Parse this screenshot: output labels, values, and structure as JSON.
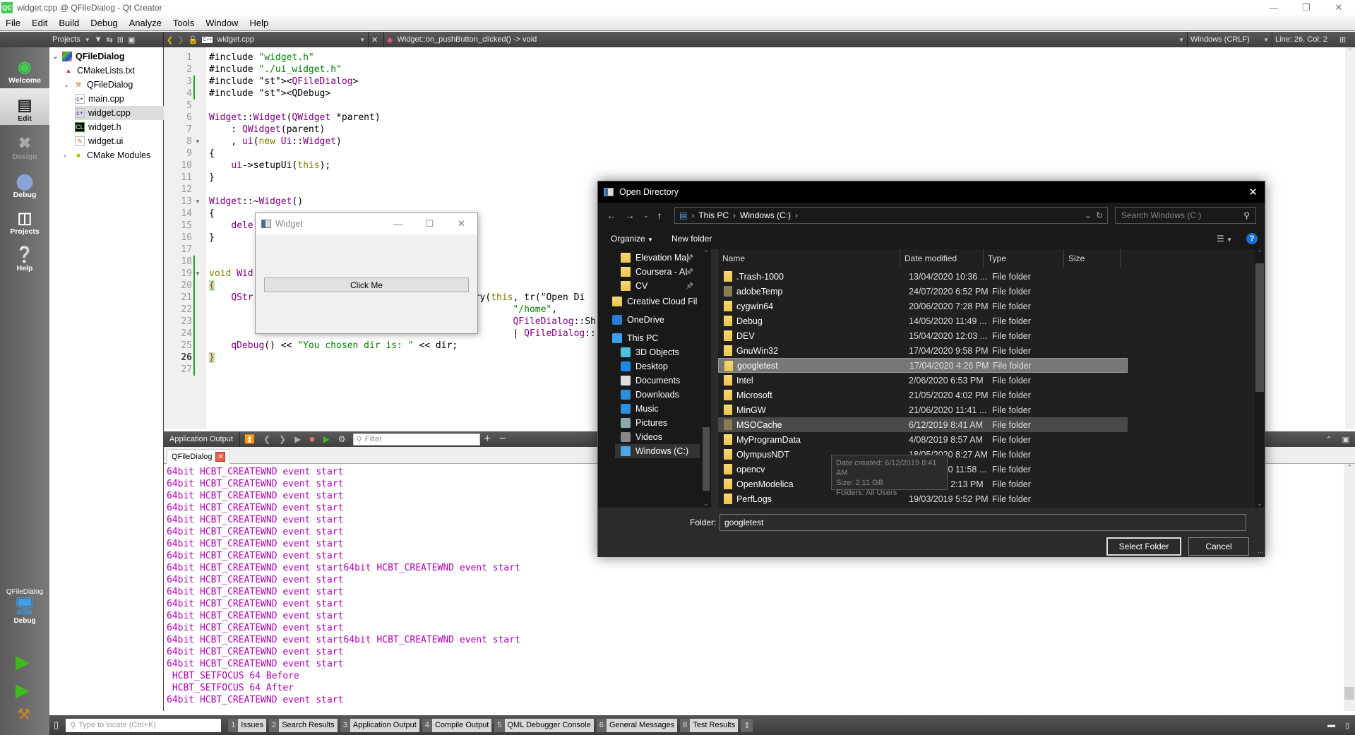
{
  "window": {
    "title": "widget.cpp @ QFileDialog - Qt Creator",
    "app_icon": "QC",
    "controls": [
      "minimize",
      "restore",
      "close"
    ]
  },
  "menubar": [
    "File",
    "Edit",
    "Build",
    "Debug",
    "Analyze",
    "Tools",
    "Window",
    "Help"
  ],
  "editor_toolbar": {
    "projects_label": "Projects",
    "file_name": "widget.cpp",
    "symbol": "Widget::on_pushButton_clicked() -> void",
    "line_ending": "Windows (CRLF)",
    "cursor_position": "Line: 26, Col: 2"
  },
  "modes": [
    {
      "label": "Welcome",
      "icon": "qt-logo-icon",
      "state": "normal"
    },
    {
      "label": "Edit",
      "icon": "edit-document-icon",
      "state": "active"
    },
    {
      "label": "Design",
      "icon": "design-tools-icon",
      "state": "disabled"
    },
    {
      "label": "Debug",
      "icon": "bug-icon",
      "state": "normal"
    },
    {
      "label": "Projects",
      "icon": "projects-folder-icon",
      "state": "normal"
    },
    {
      "label": "Help",
      "icon": "help-icon",
      "state": "normal"
    }
  ],
  "kit_selector": {
    "project": "QFileDialog",
    "config": "Debug"
  },
  "project_tree": [
    {
      "label": "QFileDialog",
      "level": 0,
      "expanded": true,
      "bold": true,
      "icon": "project-icon"
    },
    {
      "label": "CMakeLists.txt",
      "level": 1,
      "icon": "cmake-icon"
    },
    {
      "label": "QFileDialog",
      "level": 1,
      "expanded": true,
      "icon": "build-hammer-icon"
    },
    {
      "label": "main.cpp",
      "level": 2,
      "icon": "cpp-file-icon"
    },
    {
      "label": "widget.cpp",
      "level": 2,
      "icon": "cpp-file-icon",
      "selected": true
    },
    {
      "label": "widget.h",
      "level": 2,
      "icon": "header-file-icon"
    },
    {
      "label": "widget.ui",
      "level": 2,
      "icon": "ui-file-icon"
    },
    {
      "label": "CMake Modules",
      "level": 1,
      "expanded": false,
      "icon": "cmake-modules-icon"
    }
  ],
  "code": {
    "current_line": 26,
    "lines": [
      "#include \"widget.h\"",
      "#include \"./ui_widget.h\"",
      "#include <QFileDialog>",
      "#include <QDebug>",
      "",
      "Widget::Widget(QWidget *parent)",
      "    : QWidget(parent)",
      "    , ui(new Ui::Widget)",
      "{",
      "    ui->setupUi(this);",
      "}",
      "",
      "Widget::~Widget()",
      "{",
      "    dele",
      "}",
      "",
      "",
      "void Wid",
      "{",
      "    QStr                                      tory(this, tr(\"Open Di",
      "                                                       \"/home\",",
      "                                                       QFileDialog::Sh",
      "                                                       | QFileDialog::",
      "    qDebug() << \"You chosen dir is: \" << dir;",
      "}",
      ""
    ]
  },
  "widget_window": {
    "title": "Widget",
    "button_label": "Click Me"
  },
  "output_pane": {
    "title": "Application Output",
    "filter_placeholder": "Filter",
    "tab_label": "QFileDialog",
    "lines": [
      "64bit HCBT_CREATEWND event start",
      "64bit HCBT_CREATEWND event start",
      "64bit HCBT_CREATEWND event start",
      "64bit HCBT_CREATEWND event start",
      "64bit HCBT_CREATEWND event start",
      "64bit HCBT_CREATEWND event start",
      "64bit HCBT_CREATEWND event start",
      "64bit HCBT_CREATEWND event start",
      "64bit HCBT_CREATEWND event start64bit HCBT_CREATEWND event start",
      "64bit HCBT_CREATEWND event start",
      "64bit HCBT_CREATEWND event start",
      "64bit HCBT_CREATEWND event start",
      "64bit HCBT_CREATEWND event start",
      "64bit HCBT_CREATEWND event start",
      "64bit HCBT_CREATEWND event start64bit HCBT_CREATEWND event start",
      "64bit HCBT_CREATEWND event start",
      "64bit HCBT_CREATEWND event start",
      " HCBT_SETFOCUS 64 Before",
      " HCBT_SETFOCUS 64 After",
      "64bit HCBT_CREATEWND event start"
    ]
  },
  "statusbar": {
    "locate_placeholder": "Type to locate (Ctrl+K)",
    "panes": [
      {
        "num": "1",
        "label": "Issues"
      },
      {
        "num": "2",
        "label": "Search Results"
      },
      {
        "num": "3",
        "label": "Application Output"
      },
      {
        "num": "4",
        "label": "Compile Output"
      },
      {
        "num": "5",
        "label": "QML Debugger Console"
      },
      {
        "num": "6",
        "label": "General Messages"
      },
      {
        "num": "8",
        "label": "Test Results"
      }
    ]
  },
  "open_dialog": {
    "title": "Open Directory",
    "breadcrumb": [
      "This PC",
      "Windows (C:)"
    ],
    "search_placeholder": "Search Windows (C:)",
    "organize_label": "Organize",
    "new_folder_label": "New folder",
    "nav_items": [
      {
        "label": "Elevation Ma|",
        "icon": "folder-icon",
        "pinned": true,
        "indent": 1
      },
      {
        "label": "Coursera - AI",
        "icon": "folder-icon",
        "pinned": true,
        "indent": 1
      },
      {
        "label": "CV",
        "icon": "folder-icon",
        "pinned": true,
        "indent": 1
      },
      {
        "label": "Creative Cloud Fil",
        "icon": "creative-cloud-icon",
        "indent": 0
      },
      {
        "label": "OneDrive",
        "icon": "onedrive-icon",
        "indent": 0
      },
      {
        "label": "This PC",
        "icon": "computer-icon",
        "indent": 0
      },
      {
        "label": "3D Objects",
        "icon": "3d-objects-icon",
        "indent": 1
      },
      {
        "label": "Desktop",
        "icon": "desktop-icon",
        "indent": 1
      },
      {
        "label": "Documents",
        "icon": "documents-icon",
        "indent": 1
      },
      {
        "label": "Downloads",
        "icon": "downloads-icon",
        "indent": 1
      },
      {
        "label": "Music",
        "icon": "music-icon",
        "indent": 1
      },
      {
        "label": "Pictures",
        "icon": "pictures-icon",
        "indent": 1
      },
      {
        "label": "Videos",
        "icon": "videos-icon",
        "indent": 1
      },
      {
        "label": "Windows (C:)",
        "icon": "drive-icon",
        "indent": 1,
        "selected": true
      }
    ],
    "columns": [
      "Name",
      "Date modified",
      "Type",
      "Size"
    ],
    "files": [
      {
        "name": ".Trash-1000",
        "date": "13/04/2020 10:36 ...",
        "type": "File folder"
      },
      {
        "name": "adobeTemp",
        "date": "24/07/2020 6:52 PM",
        "type": "File folder",
        "hidden": true
      },
      {
        "name": "cygwin64",
        "date": "20/06/2020 7:28 PM",
        "type": "File folder"
      },
      {
        "name": "Debug",
        "date": "14/05/2020 11:49 ...",
        "type": "File folder"
      },
      {
        "name": "DEV",
        "date": "15/04/2020 12:03 ...",
        "type": "File folder"
      },
      {
        "name": "GnuWin32",
        "date": "17/04/2020 9:58 PM",
        "type": "File folder"
      },
      {
        "name": "googletest",
        "date": "17/04/2020 4:26 PM",
        "type": "File folder",
        "selected": true
      },
      {
        "name": "Intel",
        "date": "2/06/2020 6:53 PM",
        "type": "File folder"
      },
      {
        "name": "Microsoft",
        "date": "21/05/2020 4:02 PM",
        "type": "File folder"
      },
      {
        "name": "MinGW",
        "date": "21/06/2020 11:41 ...",
        "type": "File folder"
      },
      {
        "name": "MSOCache",
        "date": "6/12/2019 8:41 AM",
        "type": "File folder",
        "hidden": true,
        "hover": true
      },
      {
        "name": "MyProgramData",
        "date": "4/08/2019 8:57 AM",
        "type": "File folder"
      },
      {
        "name": "OlympusNDT",
        "date": "18/05/2020 8:27 AM",
        "type": "File folder"
      },
      {
        "name": "opencv",
        "date": "19/05/2020 11:58 ...",
        "type": "File folder"
      },
      {
        "name": "OpenModelica",
        "date": "3/05/2020 2:13 PM",
        "type": "File folder"
      },
      {
        "name": "PerfLogs",
        "date": "19/03/2019 5:52 PM",
        "type": "File folder"
      }
    ],
    "tooltip": [
      "Date created: 6/12/2019 8:41 AM",
      "Size: 2.11 GB",
      "Folders: All Users"
    ],
    "folder_label": "Folder:",
    "folder_value": "googletest",
    "select_button": "Select Folder",
    "cancel_button": "Cancel"
  }
}
